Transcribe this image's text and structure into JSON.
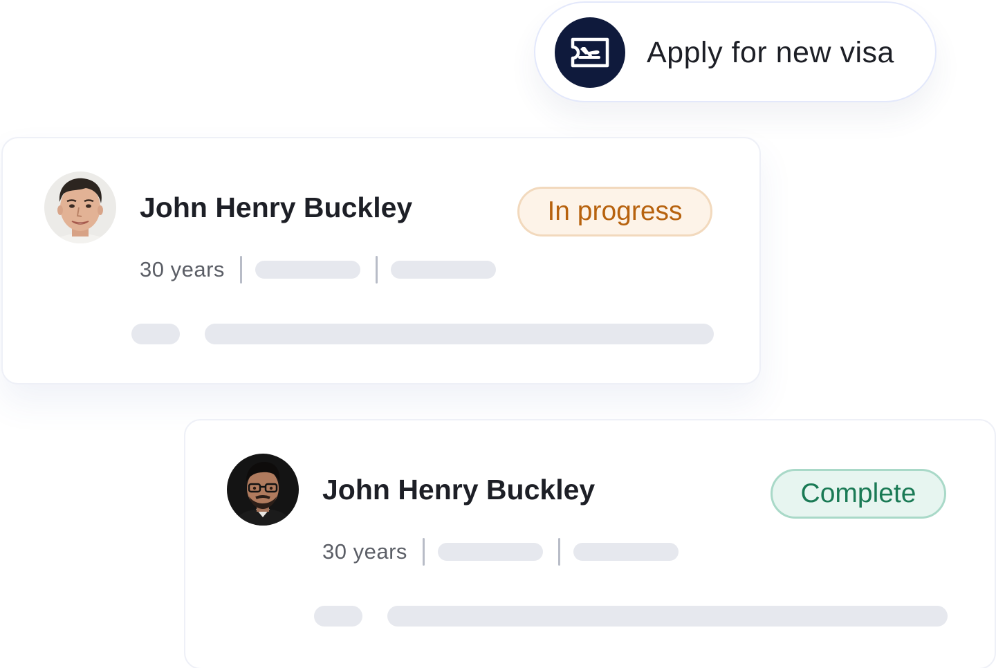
{
  "apply": {
    "label": "Apply for new visa",
    "icon": "plane-ticket-icon",
    "icon_bg": "#0f1a3c"
  },
  "applicants": [
    {
      "name": "John Henry Buckley",
      "age": "30 years",
      "status": "In progress",
      "status_color": "#b7620e",
      "avatar": "avatar-photo"
    },
    {
      "name": "John Henry Buckley",
      "age": "30 years",
      "status": "Complete",
      "status_color": "#1a7a55",
      "avatar": "avatar-photo"
    }
  ]
}
